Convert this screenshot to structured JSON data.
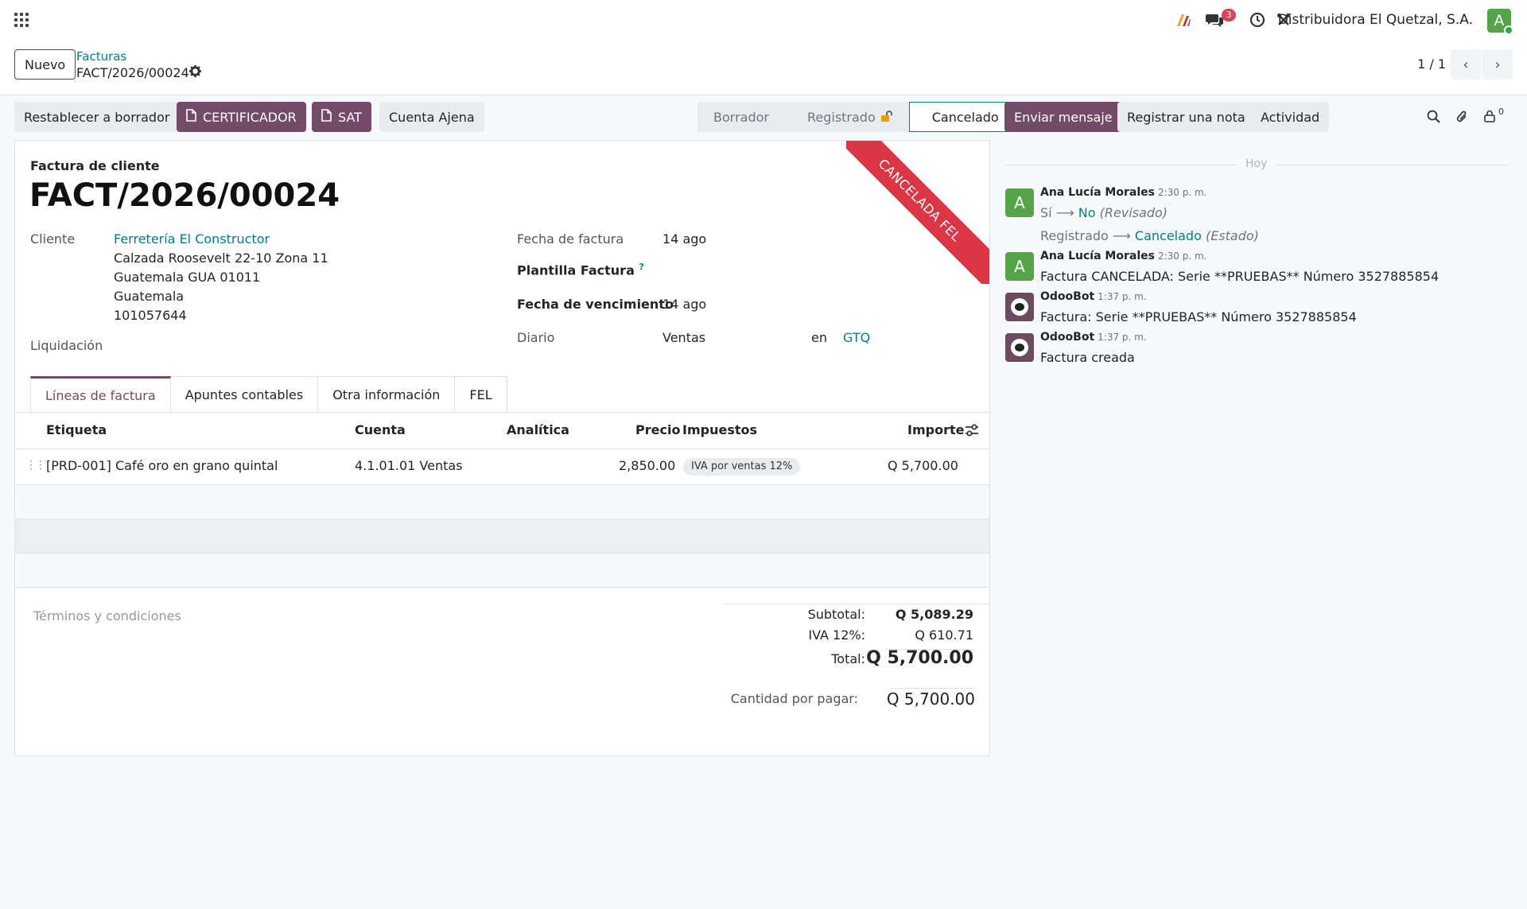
{
  "company": "Distribuidora El Quetzal, S.A.",
  "user_initial": "A",
  "messages_badge": "3",
  "breadcrumb": {
    "parent": "Facturas",
    "current": "FACT/2026/00024"
  },
  "new_button": "Nuevo",
  "pager": "1 / 1",
  "actions": {
    "reset": "Restablecer a borrador",
    "certificador": "CERTIFICADOR",
    "sat": "SAT",
    "cuenta_ajena": "Cuenta Ajena"
  },
  "status": [
    "Borrador",
    "Registrado",
    "Cancelado"
  ],
  "status_active": "Cancelado",
  "ribbon": "CANCELADA FEL",
  "invoice": {
    "type": "Factura de cliente",
    "name": "FACT/2026/00024",
    "cliente_label": "Cliente",
    "cliente": "Ferretería El Constructor",
    "address": [
      "Calzada Roosevelt 22-10 Zona 11",
      "Guatemala GUA 01011",
      "Guatemala",
      "101057644"
    ],
    "liquidacion_label": "Liquidación",
    "fecha_factura_label": "Fecha de factura",
    "fecha_factura": "14 ago",
    "plantilla_label": "Plantilla Factura",
    "plantilla_help": "?",
    "fecha_venc_label": "Fecha de vencimiento",
    "fecha_venc": "14 ago",
    "diario_label": "Diario",
    "diario": "Ventas",
    "en_label": "en",
    "currency": "GTQ"
  },
  "tabs": [
    "Líneas de factura",
    "Apuntes contables",
    "Otra información",
    "FEL"
  ],
  "table": {
    "headers": [
      "Etiqueta",
      "Cuenta",
      "Analítica",
      "Precio",
      "Impuestos",
      "Importe"
    ],
    "rows": [
      {
        "etiqueta": "[PRD-001] Café oro en grano quintal",
        "cuenta": "4.1.01.01 Ventas",
        "precio": "2,850.00",
        "impuesto": "IVA por ventas 12%",
        "importe": "Q 5,700.00"
      }
    ]
  },
  "terms_placeholder": "Términos y condiciones",
  "totals": {
    "subtotal_label": "Subtotal:",
    "subtotal": "Q 5,089.29",
    "iva_label": "IVA 12%:",
    "iva": "Q 610.71",
    "total_label": "Total:",
    "total": "Q 5,700.00",
    "due_label": "Cantidad por pagar:",
    "due": "Q 5,700.00"
  },
  "chatter": {
    "send": "Enviar mensaje",
    "note": "Registrar una nota",
    "activity": "Actividad",
    "followers_count": "0",
    "today": "Hoy",
    "messages": [
      {
        "author": "Ana Lucía Morales",
        "time": "2:30 p. m.",
        "track1_old": "Sí",
        "track1_new": "No",
        "track1_field": "(Revisado)",
        "track2_old": "Registrado",
        "track2_new": "Cancelado",
        "track2_field": "(Estado)"
      },
      {
        "author": "Ana Lucía Morales",
        "time": "2:30 p. m.",
        "text": "Factura CANCELADA: Serie **PRUEBAS** Número 3527885854"
      },
      {
        "author": "OdooBot",
        "time": "1:37 p. m.",
        "text": "Factura: Serie **PRUEBAS** Número 3527885854"
      },
      {
        "author": "OdooBot",
        "time": "1:37 p. m.",
        "text": "Factura creada"
      }
    ]
  }
}
